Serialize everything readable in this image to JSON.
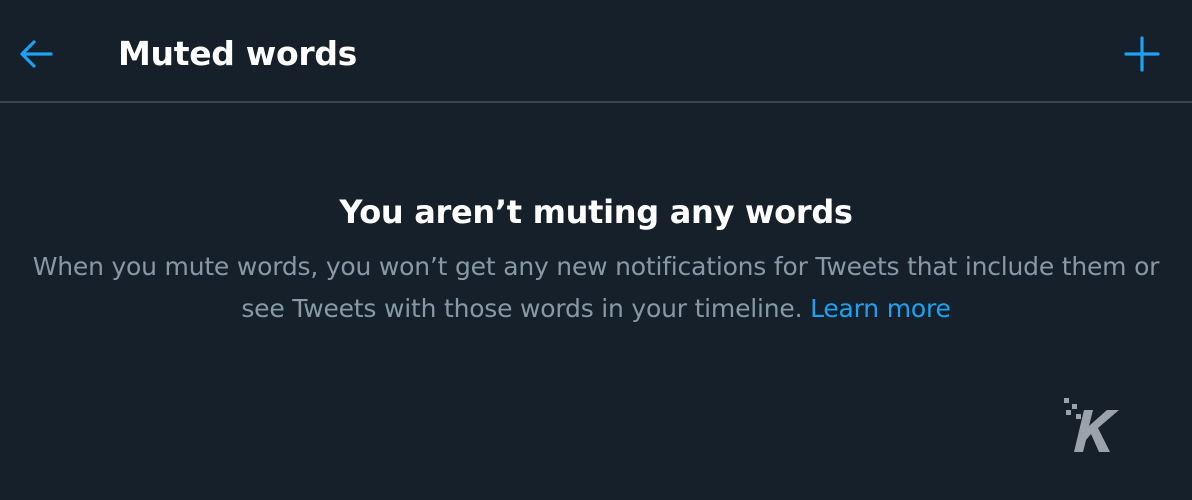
{
  "header": {
    "back_icon": "arrow-left-icon",
    "title": "Muted words",
    "add_icon": "plus-icon"
  },
  "empty_state": {
    "heading": "You aren’t muting any words",
    "description": "When you mute words, you won’t get any new notifications for Tweets that include them or see Tweets with those words in your timeline.",
    "link_text": "Learn more"
  },
  "watermark": {
    "icon": "knowtechie-logo-icon"
  },
  "colors": {
    "background": "#15202b",
    "accent": "#1da1f2",
    "secondary_text": "#8899a6",
    "divider": "#38444d"
  }
}
